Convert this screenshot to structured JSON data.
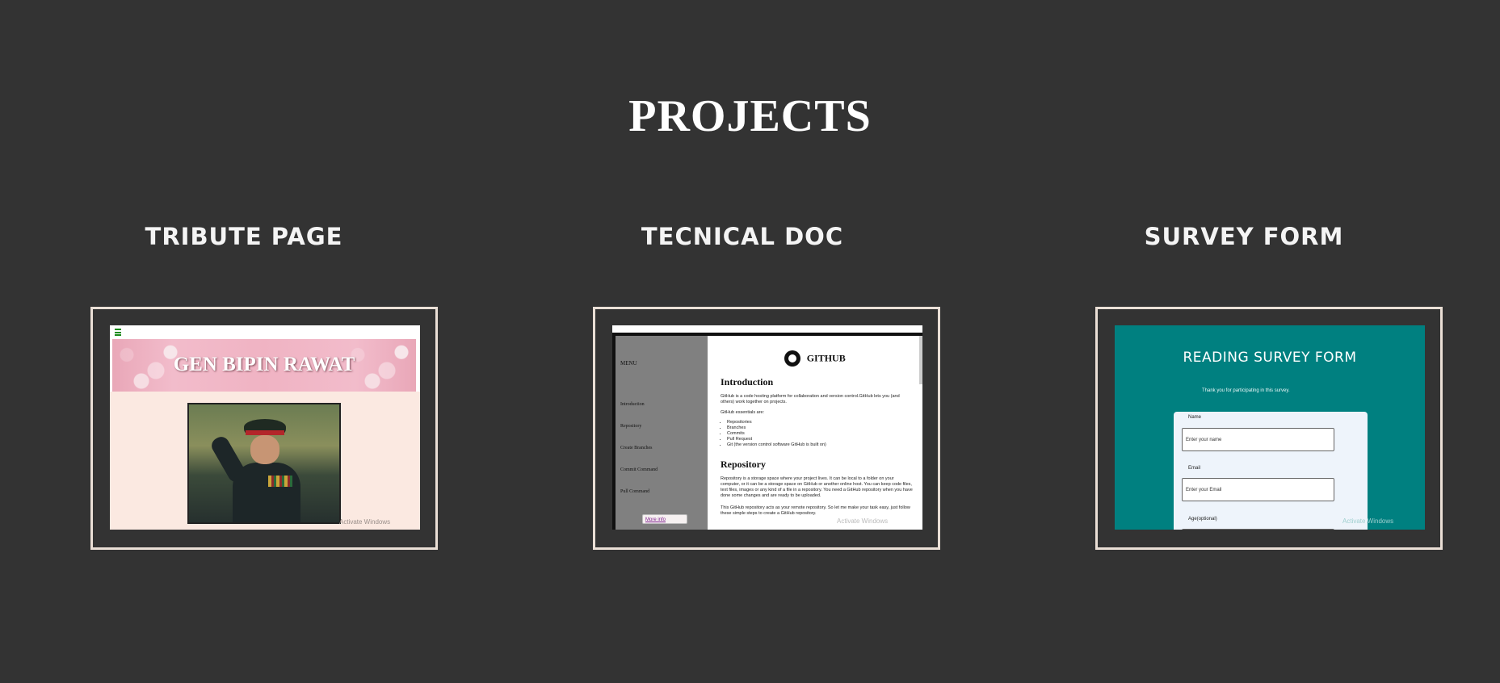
{
  "page": {
    "title": "PROJECTS"
  },
  "projects": [
    {
      "title": "TRIBUTE PAGE",
      "preview": {
        "banner_text": "GEN BIPIN RAWAT",
        "watermark": "Activate Windows"
      }
    },
    {
      "title": "TECNICAL DOC",
      "preview": {
        "menu_title": "MENU",
        "menu_links": [
          "Introduction",
          "Repository",
          "Create Branches",
          "Commit Command",
          "Pull Command"
        ],
        "more_info": "More info",
        "logo_text": "GITHUB",
        "intro_heading": "Introduction",
        "intro_p1": "GitHub is a code hosting platform for collaboration and version control.GitHub lets you (and others) work together on projects.",
        "intro_p2": "GitHub essentials are:",
        "essentials": [
          "Repositories",
          "Branches",
          "Commits",
          "Pull Request",
          "Git (the version control software GitHub is built on)"
        ],
        "repo_heading": "Repository",
        "repo_p1": "Repository is a storage space where your project lives. It can be local to a folder on your computer, or it can be a storage space on GitHub or another online host. You can keep code files, text files, images or any kind of a file in a repository. You need a GitHub repository when you have done some changes and are ready to be uploaded.",
        "repo_p2": "This GitHub repository acts as your remote repository. So let me make your task easy, just follow these simple steps to create a GitHub repository.",
        "watermark": "Activate Windows"
      }
    },
    {
      "title": "SURVEY FORM",
      "preview": {
        "form_title": "READING SURVEY FORM",
        "subtitle": "Thank you for participating in this survey.",
        "name_label": "Name",
        "name_placeholder": "Enter your name",
        "email_label": "Email",
        "email_placeholder": "Enter your Email",
        "age_label": "Age(optional)",
        "watermark": "Activate Windows"
      }
    }
  ]
}
